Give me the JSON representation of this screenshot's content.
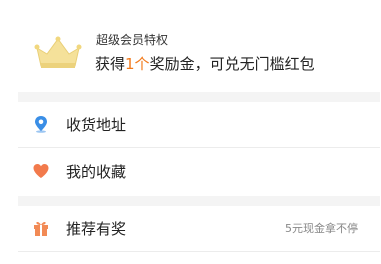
{
  "banner": {
    "subtitle": "超级会员特权",
    "title_prefix": "获得",
    "title_count": "1个",
    "title_suffix": "奖励金，可兑无门槛红包",
    "crown_color": "#f2dc8c"
  },
  "menu": {
    "address": {
      "label": "收货地址",
      "icon": "location-pin-icon",
      "icon_color": "#3a8ee6"
    },
    "favorites": {
      "label": "我的收藏",
      "icon": "heart-icon",
      "icon_color": "#f27a4c"
    },
    "invite": {
      "label": "推荐有奖",
      "icon": "gift-icon",
      "icon_color": "#f28a55",
      "hint": "5元现金拿不停"
    }
  }
}
